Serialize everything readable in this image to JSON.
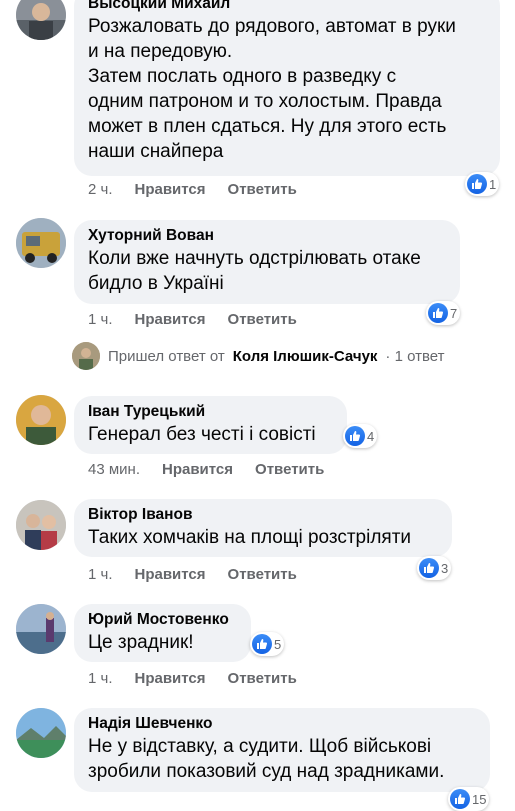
{
  "comments": [
    {
      "author": "Высоцкий Михаил",
      "text": "Розжаловать до рядового, автомат в руки\nи на передовую.\nЗатем послать одного в разведку с\nодним патроном и то холостым. Правда\nможет в плен сдаться. Ну для этого есть\nнаши снайпера",
      "time": "2 ч.",
      "like_label": "Нравится",
      "reply_label": "Ответить",
      "reaction_count": "1"
    },
    {
      "author": "Хуторний Вован",
      "text": "Коли вже начнуть одстрілювать отаке\nбидло в Україні",
      "time": "1 ч.",
      "like_label": "Нравится",
      "reply_label": "Ответить",
      "reaction_count": "7"
    },
    {
      "author": "Іван Турецький",
      "text": "Генерал без честі і совісті",
      "time": "43 мин.",
      "like_label": "Нравится",
      "reply_label": "Ответить",
      "reaction_count": "4"
    },
    {
      "author": "Віктор Іванов",
      "text": "Таких хомчаків на площі розстріляти",
      "time": "1 ч.",
      "like_label": "Нравится",
      "reply_label": "Ответить",
      "reaction_count": "3"
    },
    {
      "author": "Юрий Мостовенко",
      "text": "Це зрадник!",
      "time": "1 ч.",
      "like_label": "Нравится",
      "reply_label": "Ответить",
      "reaction_count": "5"
    },
    {
      "author": "Надія Шевченко",
      "text": "Не у відставку, а судити. Щоб військові\nзробили показовий суд над зрадниками.",
      "time": "",
      "like_label": "",
      "reply_label": "",
      "reaction_count": "15"
    }
  ],
  "reply_summary": {
    "prefix": "Пришел ответ от",
    "name": "Коля Ілюшик-Сачук",
    "count": "· 1 ответ"
  },
  "colors": {
    "bubble": "#f0f2f5",
    "like_blue": "#1877f2",
    "meta_gray": "#65676b"
  },
  "icons": {
    "like": "thumbs-up-icon"
  }
}
